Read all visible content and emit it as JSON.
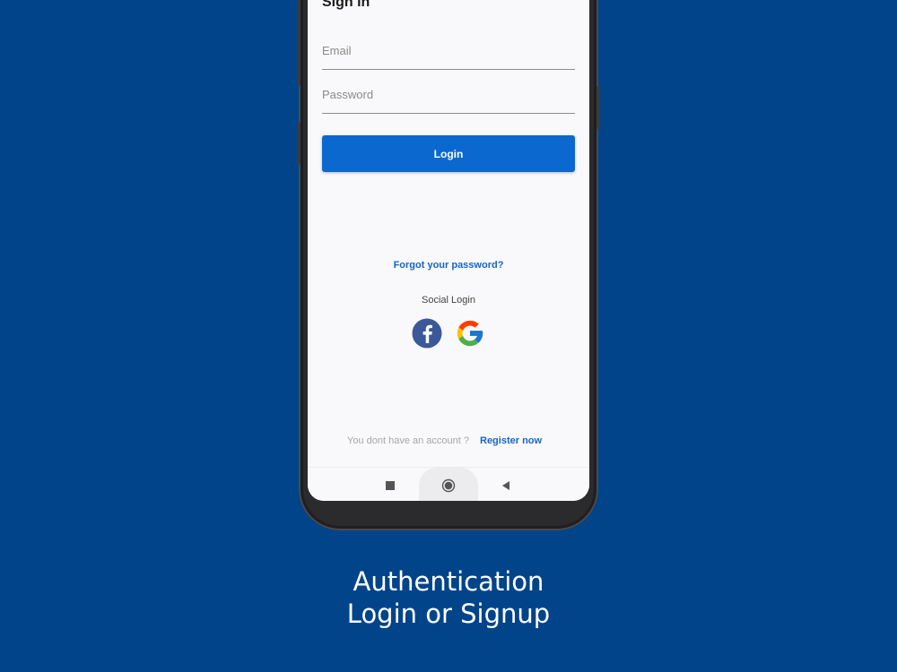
{
  "screen": {
    "title": "Sign in",
    "email": {
      "placeholder": "Email",
      "value": ""
    },
    "password": {
      "placeholder": "Password",
      "value": ""
    },
    "login_label": "Login",
    "forgot_label": "Forgot your password?",
    "social_label": "Social Login",
    "social_icons": [
      "facebook-icon",
      "google-icon"
    ],
    "footer_text": "You dont have an account ?",
    "register_label": "Register now"
  },
  "navbar": {
    "icons": [
      "recent-apps-icon",
      "home-icon",
      "back-icon"
    ]
  },
  "caption": {
    "line1": "Authentication",
    "line2": "Login or Signup"
  },
  "colors": {
    "background": "#01448a",
    "primary": "#0b68cf",
    "link": "#1565c8",
    "facebook": "#3b5998"
  }
}
